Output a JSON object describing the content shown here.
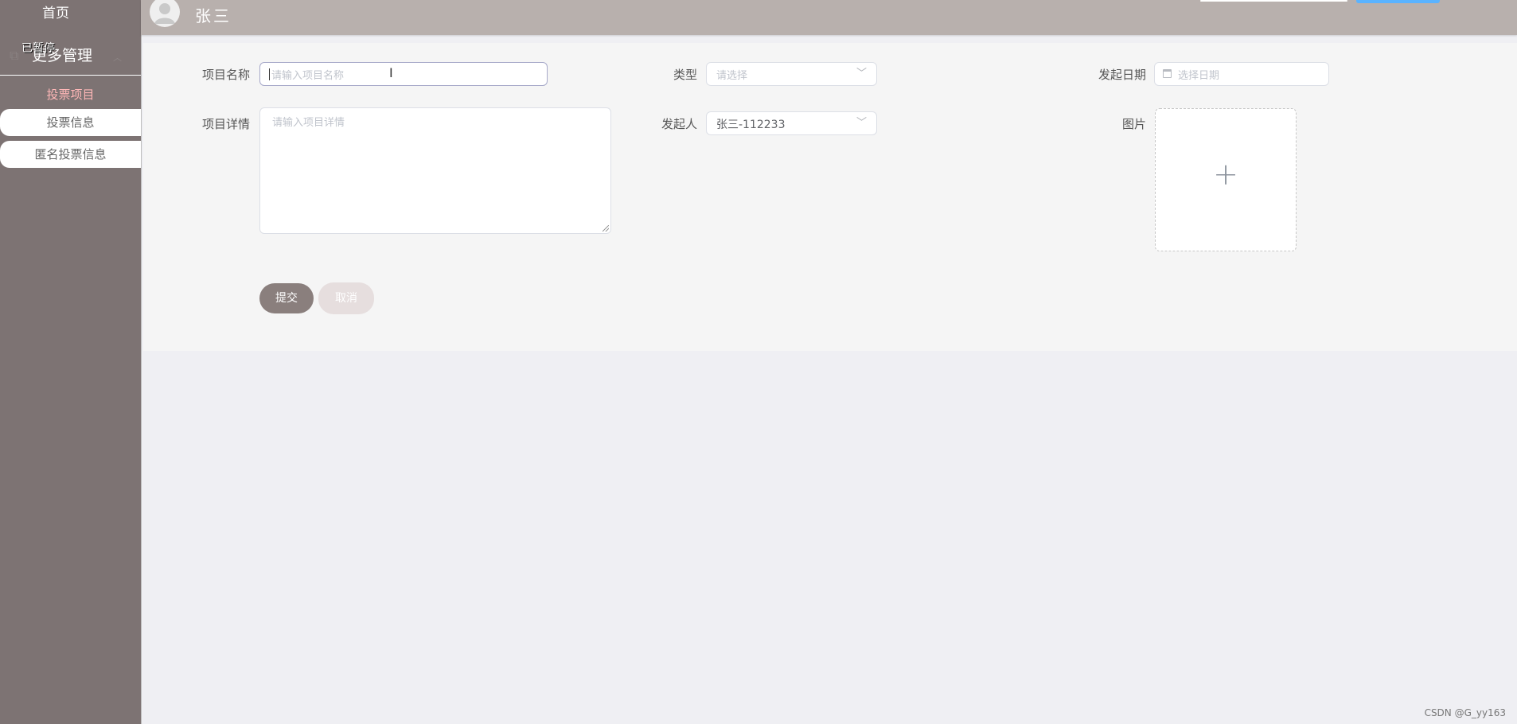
{
  "sidebar": {
    "home_label": "首页",
    "group_label": "更多管理",
    "group_overlay_label": "已暂停",
    "items": [
      {
        "label": "投票项目",
        "active": true
      },
      {
        "label": "投票信息",
        "active": false
      },
      {
        "label": "匿名投票信息",
        "active": false
      }
    ]
  },
  "header": {
    "user_name": "张三"
  },
  "form": {
    "name": {
      "label": "项目名称",
      "placeholder": "请输入项目名称",
      "value": ""
    },
    "type": {
      "label": "类型",
      "placeholder": "请选择",
      "value": ""
    },
    "date": {
      "label": "发起日期",
      "placeholder": "选择日期",
      "value": ""
    },
    "detail": {
      "label": "项目详情",
      "placeholder": "请输入项目详情",
      "value": ""
    },
    "initiator": {
      "label": "发起人",
      "value": "张三-112233"
    },
    "image": {
      "label": "图片",
      "upload_symbol": "+"
    },
    "submit_label": "提交",
    "cancel_label": "取消"
  },
  "watermark": "CSDN @G_yy163",
  "colors": {
    "sidebar_bg": "#7d7373",
    "header_bg": "#b8b0ad",
    "active_menu_text": "#ffb7b7",
    "submit_button": "#8a7f7d",
    "cancel_button": "#e6dede"
  }
}
